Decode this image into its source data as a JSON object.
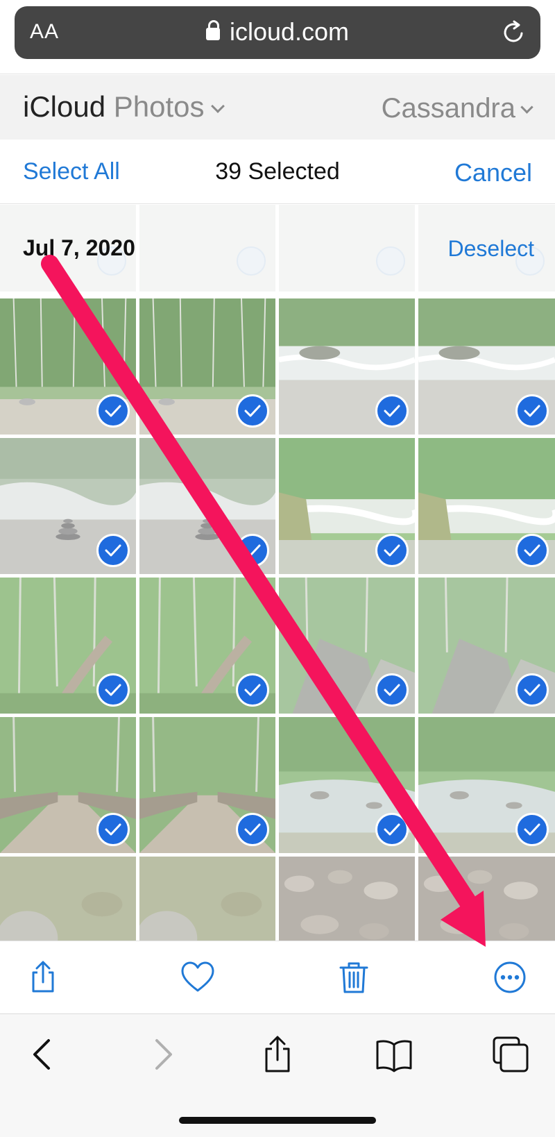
{
  "browser": {
    "text_size_label": "AA",
    "url": "icloud.com",
    "icons": {
      "lock": "lock-icon",
      "reload": "reload-icon"
    }
  },
  "header": {
    "logo_main": "iCloud",
    "logo_sub": "Photos",
    "user_name": "Cassandra"
  },
  "selection_bar": {
    "select_all": "Select All",
    "count": "39 Selected",
    "cancel": "Cancel"
  },
  "section": {
    "date": "Jul 7, 2020",
    "deselect": "Deselect"
  },
  "photos": [
    {
      "scene": "forest-river",
      "selected": true
    },
    {
      "scene": "forest-river",
      "selected": true
    },
    {
      "scene": "rapids",
      "selected": true
    },
    {
      "scene": "rapids",
      "selected": true
    },
    {
      "scene": "rock-cairn",
      "selected": true
    },
    {
      "scene": "rock-cairn",
      "selected": true
    },
    {
      "scene": "mossy-rapids",
      "selected": true
    },
    {
      "scene": "mossy-rapids",
      "selected": true
    },
    {
      "scene": "forest-trail",
      "selected": true
    },
    {
      "scene": "forest-trail",
      "selected": true
    },
    {
      "scene": "boulders",
      "selected": true
    },
    {
      "scene": "boulders",
      "selected": true
    },
    {
      "scene": "bridge",
      "selected": true
    },
    {
      "scene": "bridge",
      "selected": true
    },
    {
      "scene": "stream",
      "selected": true
    },
    {
      "scene": "stream",
      "selected": true
    },
    {
      "scene": "riverbed",
      "selected": false
    },
    {
      "scene": "riverbed",
      "selected": false
    },
    {
      "scene": "river-stones",
      "selected": false
    },
    {
      "scene": "river-stones",
      "selected": false
    }
  ],
  "toolbar": {
    "icons": [
      "share-icon",
      "heart-icon",
      "trash-icon",
      "more-icon"
    ]
  },
  "browser_nav": {
    "icons": [
      "back-icon",
      "forward-icon",
      "share-icon",
      "bookmarks-icon",
      "tabs-icon"
    ]
  },
  "colors": {
    "accent": "#2079d6",
    "check": "#1f6bde",
    "arrow": "#f4145c",
    "url_bar": "#454545"
  }
}
